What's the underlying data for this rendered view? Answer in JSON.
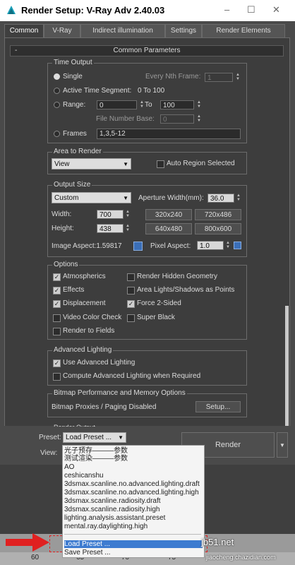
{
  "window": {
    "title": "Render Setup: V-Ray Adv 2.40.03",
    "minimize": "–",
    "maximize": "☐",
    "close": "✕"
  },
  "tabs": [
    "Common",
    "V-Ray",
    "Indirect illumination",
    "Settings",
    "Render Elements"
  ],
  "rollout": {
    "toggle": "-",
    "title": "Common Parameters"
  },
  "time_output": {
    "title": "Time Output",
    "single": "Single",
    "nth_frame_label": "Every Nth Frame:",
    "nth_frame_value": "1",
    "active_segment": "Active Time Segment:",
    "active_segment_range": "0 To 100",
    "range": "Range:",
    "range_from": "0",
    "range_to_label": "To",
    "range_to": "100",
    "file_number_base_label": "File Number Base:",
    "file_number_base": "0",
    "frames": "Frames",
    "frames_value": "1,3,5-12"
  },
  "area_to_render": {
    "title": "Area to Render",
    "selected": "View",
    "auto_region": "Auto Region Selected"
  },
  "output_size": {
    "title": "Output Size",
    "preset": "Custom",
    "aperture_label": "Aperture Width(mm):",
    "aperture_value": "36.0",
    "width_label": "Width:",
    "width_value": "700",
    "height_label": "Height:",
    "height_value": "438",
    "presets": [
      "320x240",
      "720x486",
      "640x480",
      "800x600"
    ],
    "image_aspect": "Image Aspect:1.59817",
    "pixel_aspect_label": "Pixel Aspect:",
    "pixel_aspect_value": "1.0"
  },
  "options": {
    "title": "Options",
    "atmospherics": "Atmospherics",
    "render_hidden": "Render Hidden Geometry",
    "effects": "Effects",
    "area_lights": "Area Lights/Shadows as Points",
    "displacement": "Displacement",
    "force_2sided": "Force 2-Sided",
    "video_color": "Video Color Check",
    "super_black": "Super Black",
    "render_fields": "Render to Fields"
  },
  "advanced_lighting": {
    "title": "Advanced Lighting",
    "use": "Use Advanced Lighting",
    "compute": "Compute Advanced Lighting when Required"
  },
  "bitmap": {
    "title": "Bitmap Performance and Memory Options",
    "status": "Bitmap Proxies / Paging Disabled",
    "setup": "Setup..."
  },
  "render_output_title": "Render Output",
  "bottom": {
    "preset_label": "Preset:",
    "preset_value": "Load Preset ...",
    "view_label": "View:",
    "render": "Render"
  },
  "preset_menu": {
    "items": [
      "光子预存———参数",
      "测试渲染———参数",
      "AO",
      "ceshicanshu",
      "3dsmax.scanline.no.advanced.lighting.draft",
      "3dsmax.scanline.no.advanced.lighting.high",
      "3dsmax.scanline.radiosity.draft",
      "3dsmax.scanline.radiosity.high",
      "lighting.analysis.assistant.preset",
      "mental.ray.daylighting.high"
    ],
    "load": "Load Preset ...",
    "save": "Save Preset ..."
  },
  "timeline": {
    "ticks": [
      "60",
      "65",
      "70",
      "75"
    ]
  },
  "watermark": {
    "line1": "jb51.net",
    "line2": "jiaocheng.chazidian.com"
  },
  "colors": {
    "highlight": "#3d7bd0",
    "arrow": "#e02020"
  }
}
